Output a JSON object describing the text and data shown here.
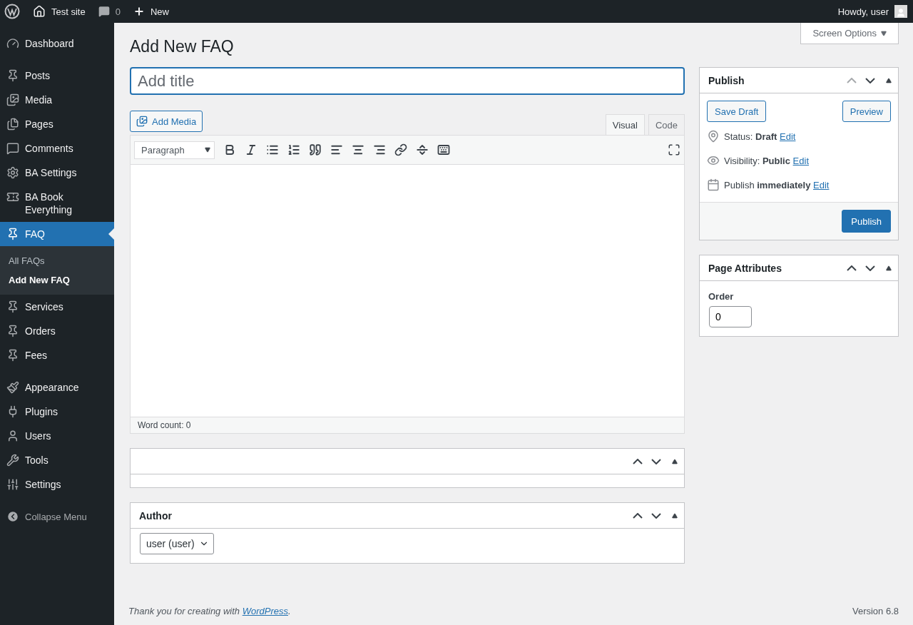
{
  "admin_bar": {
    "site": "Test site",
    "comments": "0",
    "new": "New",
    "greeting": "Howdy, user"
  },
  "sidebar": {
    "groups": [
      [
        {
          "label": "Dashboard",
          "selected": false
        }
      ],
      [
        {
          "label": "Posts",
          "selected": false
        },
        {
          "label": "Media",
          "selected": false
        },
        {
          "label": "Pages",
          "selected": false
        },
        {
          "label": "Comments",
          "selected": false
        },
        {
          "label": "BA Settings",
          "selected": false
        },
        {
          "label": "BA Book Everything",
          "selected": false
        },
        {
          "label": "FAQ",
          "selected": true,
          "children": [
            {
              "label": "All FAQs",
              "selected": false
            },
            {
              "label": "Add New FAQ",
              "selected": true
            }
          ]
        },
        {
          "label": "Services",
          "selected": false
        },
        {
          "label": "Orders",
          "selected": false
        },
        {
          "label": "Fees",
          "selected": false
        }
      ],
      [
        {
          "label": "Appearance",
          "selected": false
        },
        {
          "label": "Plugins",
          "selected": false
        },
        {
          "label": "Users",
          "selected": false
        },
        {
          "label": "Tools",
          "selected": false
        },
        {
          "label": "Settings",
          "selected": false
        }
      ]
    ],
    "collapse": "Collapse Menu"
  },
  "screen_options": "Screen Options",
  "page_title": "Add New FAQ",
  "title_field": {
    "placeholder": "Add title"
  },
  "editor": {
    "add_media": "Add Media",
    "tabs": [
      {
        "label": "Visual",
        "selected": true
      },
      {
        "label": "Code",
        "selected": false
      }
    ],
    "format": "Paragraph",
    "word_count": "Word count: 0"
  },
  "main_boxes": [
    {
      "kind": "empty"
    },
    {
      "kind": "select",
      "title": "Author",
      "value": "user (user)"
    }
  ],
  "publish": {
    "title": "Publish",
    "can_move_up": false,
    "save_draft": "Save Draft",
    "preview": "Preview",
    "rows": [
      {
        "text": "Status: **Draft**",
        "link": "Edit"
      },
      {
        "text": "Visibility: **Public**",
        "link": "Edit"
      },
      {
        "text": "Publish **immediately**",
        "link": "Edit"
      }
    ],
    "button": "Publish"
  },
  "page_attributes": {
    "title": "Page Attributes",
    "can_move_up": true,
    "label": "Order",
    "value": "0"
  },
  "footer": {
    "text": "Thank you for creating with",
    "link": "WordPress",
    "after": ".",
    "version": "Version 6.8"
  }
}
